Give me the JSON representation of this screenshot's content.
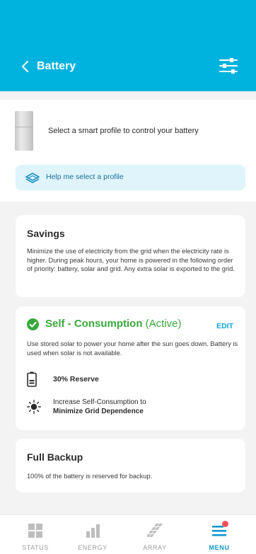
{
  "header": {
    "title": "Battery",
    "background_color": "#00b2de",
    "back_icon": "chevron-left-icon",
    "filter_icon": "sliders-icon"
  },
  "intro": {
    "select_text": "Select a smart profile to control your battery",
    "help_label": "Help me select a profile",
    "help_icon": "book-stack-icon"
  },
  "profiles": {
    "savings": {
      "title": "Savings",
      "description": "Minimize the use of electricity from the grid when the electricity rate is higher. During peak hours, your home is powered in the following order of priority: battery, solar and grid. Any extra solar is exported to the grid."
    },
    "self_consumption": {
      "title": "Self - Consumption",
      "status": "(Active)",
      "edit_label": "EDIT",
      "description": "Use stored solar to power your home after the sun goes down. Battery is used when solar is not available.",
      "reserve_label": "30% Reserve",
      "goal_line1": "Increase Self-Consumption to",
      "goal_line2": "Minimize Grid Dependence",
      "accent_color": "#39a93c"
    },
    "full_backup": {
      "title": "Full Backup",
      "description": "100% of the battery is reserved for backup."
    }
  },
  "nav": {
    "items": [
      {
        "label": "STATUS",
        "icon": "grid-icon"
      },
      {
        "label": "ENERGY",
        "icon": "bar-chart-icon"
      },
      {
        "label": "ARRAY",
        "icon": "solar-array-icon"
      },
      {
        "label": "MENU",
        "icon": "menu-icon"
      }
    ],
    "active_color": "#1098cf",
    "badge_color": "#f0505d"
  }
}
